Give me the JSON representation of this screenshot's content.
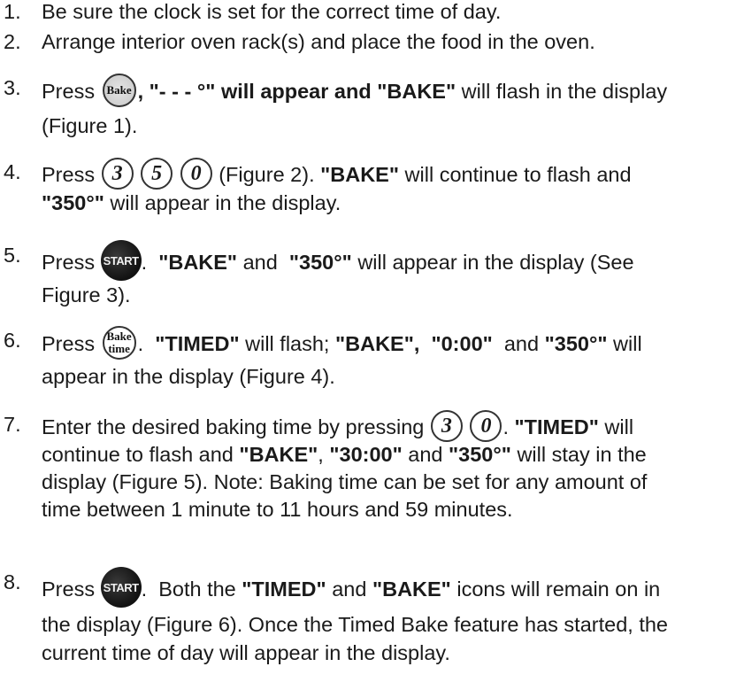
{
  "steps": [
    {
      "number": "1.",
      "text": "Be sure the clock is set for the correct time of day."
    },
    {
      "number": "2.",
      "text": "Arrange interior oven rack(s) and place the food in the oven."
    },
    {
      "number": "3.",
      "press": "Press",
      "key_bake": "Bake",
      "after_key": ", \"- - - °\" will appear and ",
      "bake_word": "\"BAKE\"",
      "rest": " will flash in the display",
      "line2": "(Figure 1)."
    },
    {
      "number": "4.",
      "press": "Press",
      "keys": [
        "3",
        "5",
        "0"
      ],
      "after_keys": "(Figure 2).",
      "bake_word": "\"BAKE\"",
      "rest": "will continue to flash and",
      "temp": "\"350°\"",
      "line2_rest": "will appear in the display."
    },
    {
      "number": "5.",
      "press": "Press",
      "key_start": "START",
      "dot": ".",
      "bake_word": "\"BAKE\"",
      "and": "and",
      "temp": "\"350°\"",
      "rest": "will appear in the display (See",
      "line2": "Figure 3)."
    },
    {
      "number": "6.",
      "press": "Press",
      "key_baketime_1": "Bake",
      "key_baketime_2": "time",
      "dot": ".",
      "timed_word": "\"TIMED\"",
      "flash": "will flash;",
      "bake_word": "\"BAKE\",",
      "time": "\"0:00\"",
      "and": "and",
      "temp": "\"350°\"",
      "will": "will",
      "line2": "appear in the display (Figure 4)."
    },
    {
      "number": "7.",
      "line1": "Enter the desired baking time by pressing",
      "keys": [
        "3",
        "0"
      ],
      "dot": ".",
      "timed_word": "\"TIMED\"",
      "will": "will",
      "line2_a": "continue to flash and",
      "line2_bake": "\"BAKE\"",
      "line2_b": ",",
      "line2_time": "\"30:00\"",
      "line2_c": "and",
      "line2_temp": "\"350°\"",
      "line2_d": "will stay in the",
      "line3": "display (Figure 5). Note: Baking time can be set for any amount of",
      "line4": "time between 1 minute to 11 hours and 59 minutes."
    },
    {
      "number": "8.",
      "press": "Press",
      "key_start": "START",
      "dot": ".",
      "both": "Both the",
      "timed_word": "\"TIMED\"",
      "and": "and",
      "bake_word": "\"BAKE\"",
      "rest": "icons will remain on in",
      "line2": "the display (Figure 6). Once the Timed Bake feature has started, the",
      "line3": "current time of day will appear in the display."
    }
  ]
}
